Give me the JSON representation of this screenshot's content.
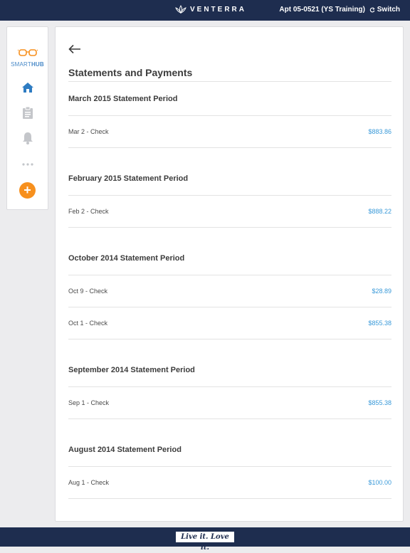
{
  "header": {
    "brand": "VENTERRA",
    "apartment": "Apt 05-0521 (YS Training)",
    "switch_label": "Switch"
  },
  "sidebar": {
    "logo_smart": "SMART",
    "logo_hub": "HUB",
    "items": [
      {
        "name": "home",
        "icon": "home-icon",
        "active": true
      },
      {
        "name": "clipboard",
        "icon": "clipboard-icon",
        "active": false
      },
      {
        "name": "notifications",
        "icon": "bell-icon",
        "active": false
      },
      {
        "name": "more",
        "icon": "more-icon",
        "active": false
      }
    ],
    "add_label": "+"
  },
  "main": {
    "title": "Statements and Payments",
    "periods": [
      {
        "label": "March 2015 Statement Period",
        "rows": [
          {
            "desc": "Mar 2 - Check",
            "amount": "$883.86"
          }
        ]
      },
      {
        "label": "February 2015 Statement Period",
        "rows": [
          {
            "desc": "Feb 2 - Check",
            "amount": "$888.22"
          }
        ]
      },
      {
        "label": "October 2014 Statement Period",
        "rows": [
          {
            "desc": "Oct 9 - Check",
            "amount": "$28.89"
          },
          {
            "desc": "Oct 1 - Check",
            "amount": "$855.38"
          }
        ]
      },
      {
        "label": "September 2014 Statement Period",
        "rows": [
          {
            "desc": "Sep 1 - Check",
            "amount": "$855.38"
          }
        ]
      },
      {
        "label": "August 2014 Statement Period",
        "rows": [
          {
            "desc": "Aug 1 - Check",
            "amount": "$100.00"
          }
        ]
      }
    ]
  },
  "footer": {
    "tagline": "Live it. Love it."
  },
  "colors": {
    "navy": "#1e2d4f",
    "accent_blue": "#3a9ad9",
    "orange": "#f7901e"
  }
}
